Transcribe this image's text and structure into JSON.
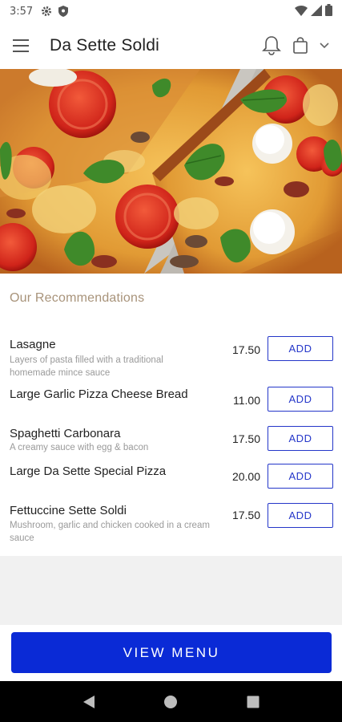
{
  "status_bar": {
    "time": "3:57",
    "icons": [
      "gear-icon",
      "shield-icon",
      "wifi-icon",
      "signal-icon",
      "battery-icon"
    ]
  },
  "app_bar": {
    "title": "Da Sette Soldi",
    "icons": [
      "hamburger-menu-icon",
      "bell-icon",
      "shopping-bag-icon",
      "chevron-down-icon"
    ]
  },
  "hero": {
    "image": "pizza-photo"
  },
  "recommendations": {
    "title": "Our Recommendations",
    "items": [
      {
        "name": "Lasagne",
        "description": "Layers of pasta filled with a traditional homemade mince sauce",
        "price": "17.50",
        "button": "ADD"
      },
      {
        "name": "Large Garlic Pizza Cheese Bread",
        "description": "",
        "price": "11.00",
        "button": "ADD"
      },
      {
        "name": "Spaghetti Carbonara",
        "description": "A creamy sauce with egg & bacon",
        "price": "17.50",
        "button": "ADD"
      },
      {
        "name": "Large Da Sette Special Pizza",
        "description": "",
        "price": "20.00",
        "button": "ADD"
      },
      {
        "name": "Fettuccine Sette Soldi",
        "description": "Mushroom, garlic and chicken cooked in a cream sauce",
        "price": "17.50",
        "button": "ADD"
      }
    ]
  },
  "footer": {
    "view_menu_label": "VIEW MENU"
  },
  "nav_bar": {
    "icons": [
      "back-icon",
      "home-icon",
      "recents-icon"
    ]
  },
  "colors": {
    "accent": "#0a2ad6",
    "add_button": "#2436c9",
    "section_title": "#a8937a"
  }
}
